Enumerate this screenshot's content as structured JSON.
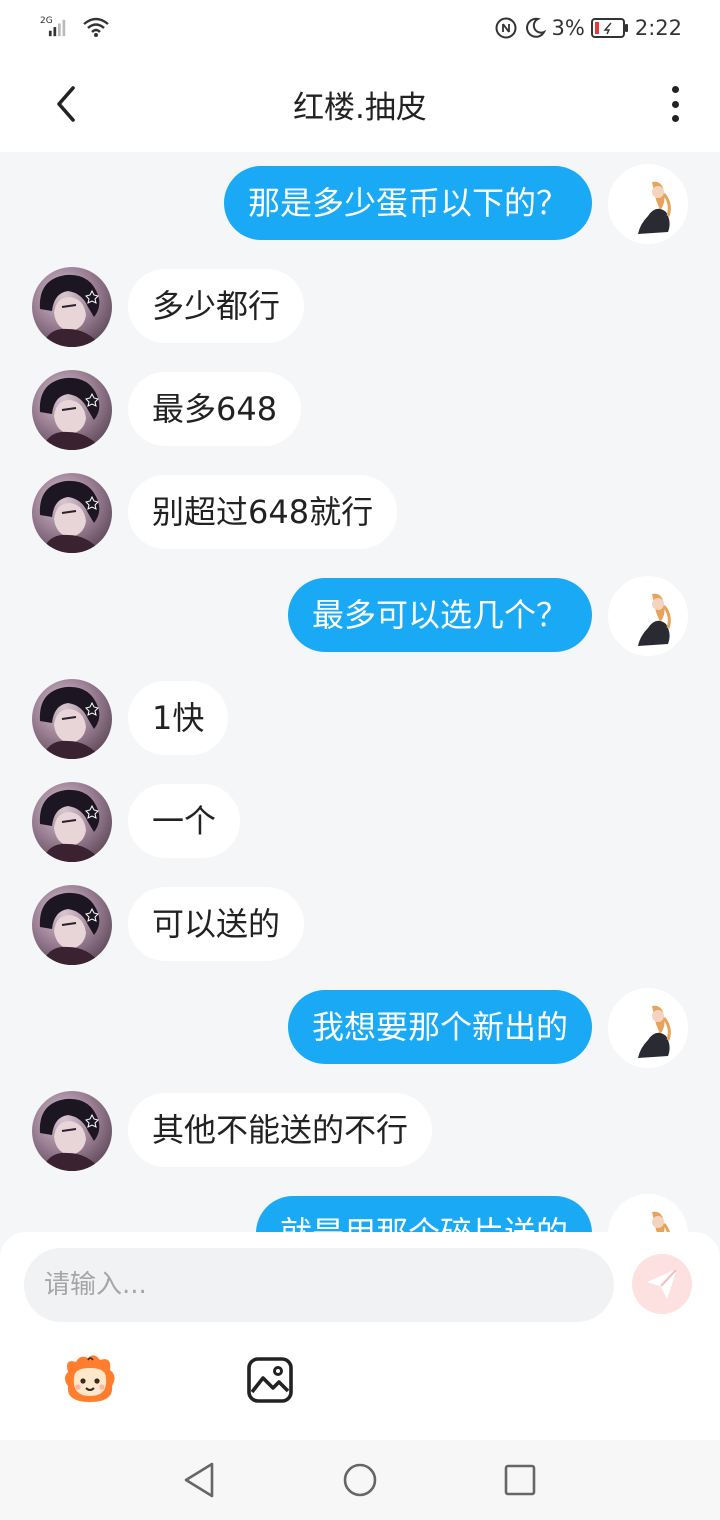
{
  "status_bar": {
    "network_type": "2G",
    "battery_percent": "3%",
    "time": "2:22",
    "icons": [
      "signal-icon",
      "wifi-icon",
      "nfc-icon",
      "moon-icon",
      "battery-icon"
    ]
  },
  "header": {
    "title": "红楼.抽皮",
    "back_icon": "chevron-left-icon",
    "more_icon": "more-vertical-icon"
  },
  "messages": [
    {
      "side": "out",
      "text": "那是多少蛋币以下的？"
    },
    {
      "side": "in",
      "text": "多少都行"
    },
    {
      "side": "in",
      "text": "最多648"
    },
    {
      "side": "in",
      "text": "别超过648就行"
    },
    {
      "side": "out",
      "text": "最多可以选几个？"
    },
    {
      "side": "in",
      "text": "1快"
    },
    {
      "side": "in",
      "text": "一个"
    },
    {
      "side": "in",
      "text": "可以送的"
    },
    {
      "side": "out",
      "text": "我想要那个新出的"
    },
    {
      "side": "in",
      "text": "其他不能送的不行"
    },
    {
      "side": "out",
      "text": "就是用那个碎片送的"
    }
  ],
  "input": {
    "placeholder": "请输入..."
  },
  "toolbar": {
    "send_icon": "send-icon",
    "emoji_icon": "emoji-mascot-icon",
    "image_icon": "image-icon"
  },
  "colors": {
    "outgoing_bubble": "#1aaaf5",
    "incoming_bubble": "#ffffff",
    "chat_background": "#f4f6f8",
    "send_button": "#fde1e1"
  }
}
